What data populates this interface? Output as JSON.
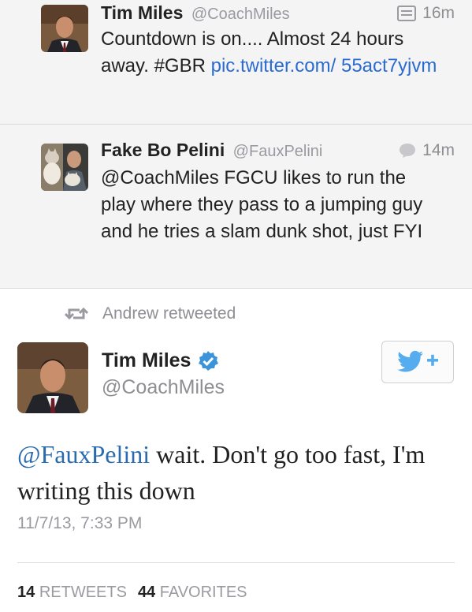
{
  "thread": [
    {
      "name": "Tim Miles",
      "handle": "@CoachMiles",
      "time": "16m",
      "meta_icon": "photo-card-icon",
      "text_before": "Countdown is on.... Almost 24 hours away. #GBR ",
      "link_text": "pic.twitter.com/ 55act7yjvm"
    },
    {
      "name": "Fake Bo Pelini",
      "handle": "@FauxPelini",
      "time": "14m",
      "meta_icon": "reply-bubble-icon",
      "text": "@CoachMiles FGCU likes to run the play where they pass to a jumping guy and he tries a slam dunk shot, just FYI"
    }
  ],
  "retweet": {
    "label": "Andrew retweeted",
    "icon": "retweet-icon"
  },
  "main": {
    "name": "Tim Miles",
    "handle": "@CoachMiles",
    "verified_icon": "verified-badge-icon",
    "follow_icon": "twitter-bird-follow-icon",
    "mention": "@FauxPelini",
    "text": " wait. Don't go too fast, I'm writing this down",
    "timestamp": "11/7/13, 7:33 PM",
    "retweets_count": "14",
    "retweets_label": "RETWEETS",
    "favorites_count": "44",
    "favorites_label": "FAVORITES"
  },
  "colors": {
    "link": "#2a6bd1",
    "verified": "#3b94d9",
    "bird": "#55acee",
    "thread_bg": "#f4f4f5",
    "muted": "#8e8e93"
  }
}
